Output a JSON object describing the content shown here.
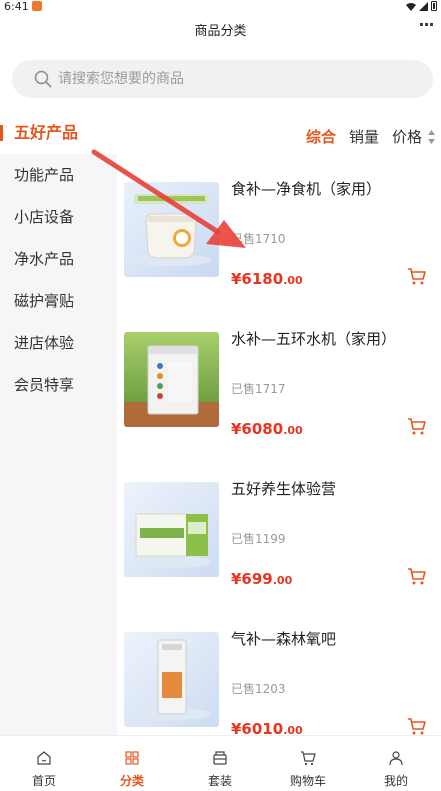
{
  "status": {
    "time": "6:41"
  },
  "nav": {
    "title": "商品分类",
    "more_label": "···"
  },
  "search": {
    "placeholder": "请搜索您想要的商品"
  },
  "sidebar": {
    "items": [
      {
        "label": "五好产品",
        "active": true
      },
      {
        "label": "功能产品"
      },
      {
        "label": "小店设备"
      },
      {
        "label": "净水产品"
      },
      {
        "label": "磁护膏贴"
      },
      {
        "label": "进店体验"
      },
      {
        "label": "会员特享"
      }
    ]
  },
  "sort": {
    "items": [
      "综合",
      "销量",
      "价格"
    ],
    "active": "综合"
  },
  "products": [
    {
      "name": "食补—净食机（家用）",
      "sold": "已售1710",
      "price_int": "¥6180",
      "price_dec": ".00"
    },
    {
      "name": "水补—五环水机（家用）",
      "sold": "已售1717",
      "price_int": "¥6080",
      "price_dec": ".00"
    },
    {
      "name": "五好养生体验营",
      "sold": "已售1199",
      "price_int": "¥699",
      "price_dec": ".00"
    },
    {
      "name": "气补—森林氧吧",
      "sold": "已售1203",
      "price_int": "¥6010",
      "price_dec": ".00"
    }
  ],
  "tabs": [
    {
      "label": "首页",
      "icon": "home-icon"
    },
    {
      "label": "分类",
      "icon": "category-icon",
      "active": true
    },
    {
      "label": "套装",
      "icon": "bundle-icon"
    },
    {
      "label": "购物车",
      "icon": "cart-icon"
    },
    {
      "label": "我的",
      "icon": "profile-icon"
    }
  ],
  "colors": {
    "accent": "#e8561f",
    "price": "#e8341f",
    "sidebar_bg": "#f6f6f8",
    "search_bg": "#f1f1f3"
  }
}
